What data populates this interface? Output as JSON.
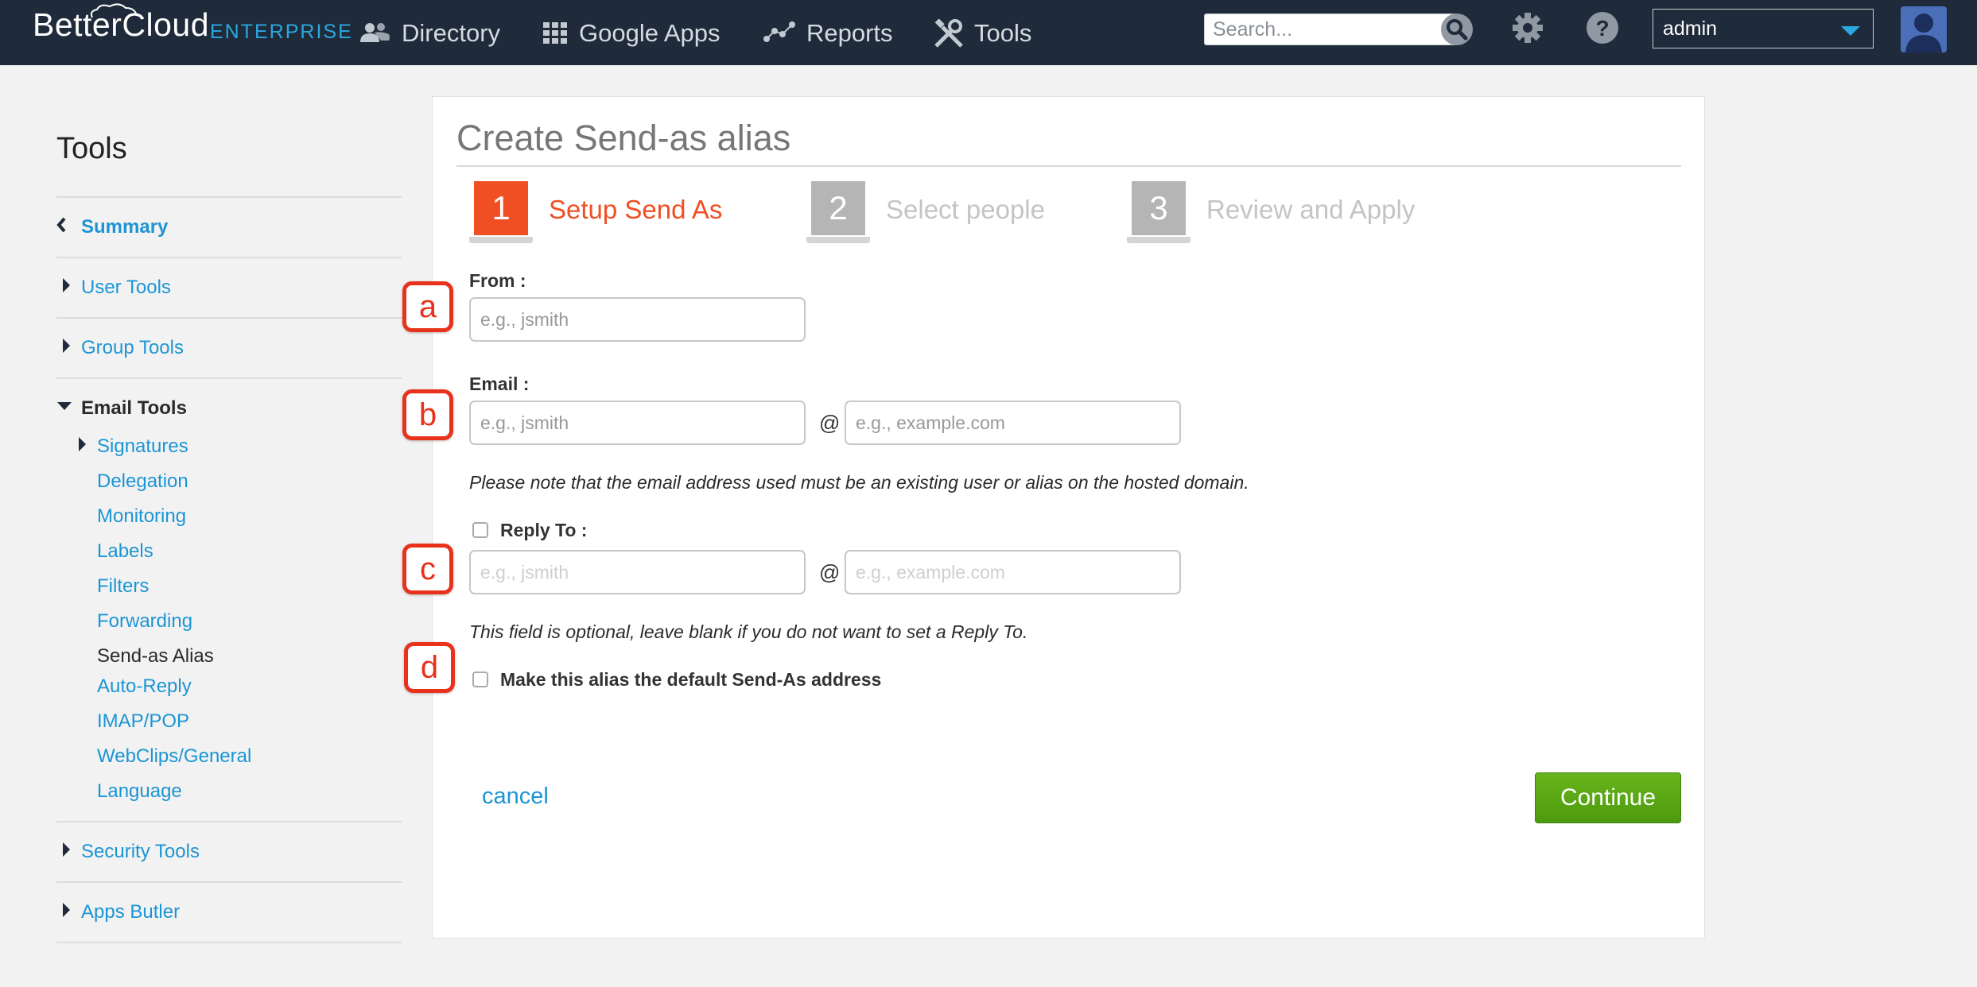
{
  "brand": {
    "name": "BetterCloud",
    "edition": "ENTERPRISE"
  },
  "nav": {
    "directory": "Directory",
    "google_apps": "Google Apps",
    "reports": "Reports",
    "tools": "Tools",
    "search_placeholder": "Search...",
    "user": "admin"
  },
  "sidebar": {
    "title": "Tools",
    "summary": "Summary",
    "user_tools": "User Tools",
    "group_tools": "Group Tools",
    "email_tools": "Email Tools",
    "email_items": [
      "Signatures",
      "Delegation",
      "Monitoring",
      "Labels",
      "Filters",
      "Forwarding",
      "Send-as Alias",
      "Auto-Reply",
      "IMAP/POP",
      "WebClips/General",
      "Language"
    ],
    "security_tools": "Security Tools",
    "apps_butler": "Apps Butler"
  },
  "main": {
    "title": "Create Send-as alias",
    "steps": [
      {
        "number": "1",
        "label": "Setup Send As"
      },
      {
        "number": "2",
        "label": "Select people"
      },
      {
        "number": "3",
        "label": "Review and Apply"
      }
    ],
    "from_label": "From :",
    "from_placeholder": "e.g., jsmith",
    "email_label": "Email :",
    "email_user_placeholder": "e.g., jsmith",
    "email_domain_placeholder": "e.g., example.com",
    "at_sign": "@",
    "email_note": "Please note that the email address used must be an existing user or alias on the hosted domain.",
    "reply_label": "Reply To :",
    "reply_user_placeholder": "e.g., jsmith",
    "reply_domain_placeholder": "e.g., example.com",
    "reply_note": "This field is optional, leave blank if you do not want to set a Reply To.",
    "default_label": "Make this alias the default Send-As address",
    "cancel": "cancel",
    "continue": "Continue"
  },
  "markers": [
    "a",
    "b",
    "c",
    "d"
  ],
  "colors": {
    "nav_bg": "#1f2b3a",
    "accent": "#1c95d4",
    "active_step": "#f04e23",
    "marker": "#e8321c",
    "continue": "#5aa815"
  }
}
